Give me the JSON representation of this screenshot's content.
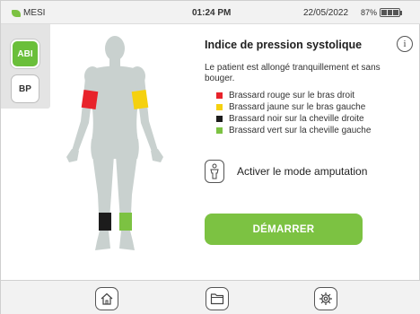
{
  "status_bar": {
    "brand": "MESI",
    "time": "01:24 PM",
    "date": "22/05/2022",
    "battery": "87%",
    "brand_color": "#7cc242"
  },
  "side_tabs": [
    {
      "label": "ABI",
      "active": true
    },
    {
      "label": "BP",
      "active": false
    }
  ],
  "main": {
    "title": "Indice de pression systolique",
    "description": "Le patient est allongé tranquillement et sans bouger.",
    "legend": [
      {
        "color": "#e8232b",
        "label": "Brassard rouge sur le bras droit"
      },
      {
        "color": "#f5d10f",
        "label": "Brassard jaune sur le bras gauche"
      },
      {
        "color": "#1c1c1c",
        "label": "Brassard noir sur la cheville droite"
      },
      {
        "color": "#7cc242",
        "label": "Brassard vert sur la cheville gauche"
      }
    ],
    "amputation_label": "Activer le mode amputation",
    "start_button": "DÉMARRER"
  },
  "colors": {
    "accent_green": "#7cc242",
    "body_silhouette": "#c9d1cf"
  },
  "icons": {
    "info": "info-icon",
    "amputation": "person-icon",
    "home": "home-icon",
    "folder": "folder-icon",
    "settings": "gear-icon"
  }
}
